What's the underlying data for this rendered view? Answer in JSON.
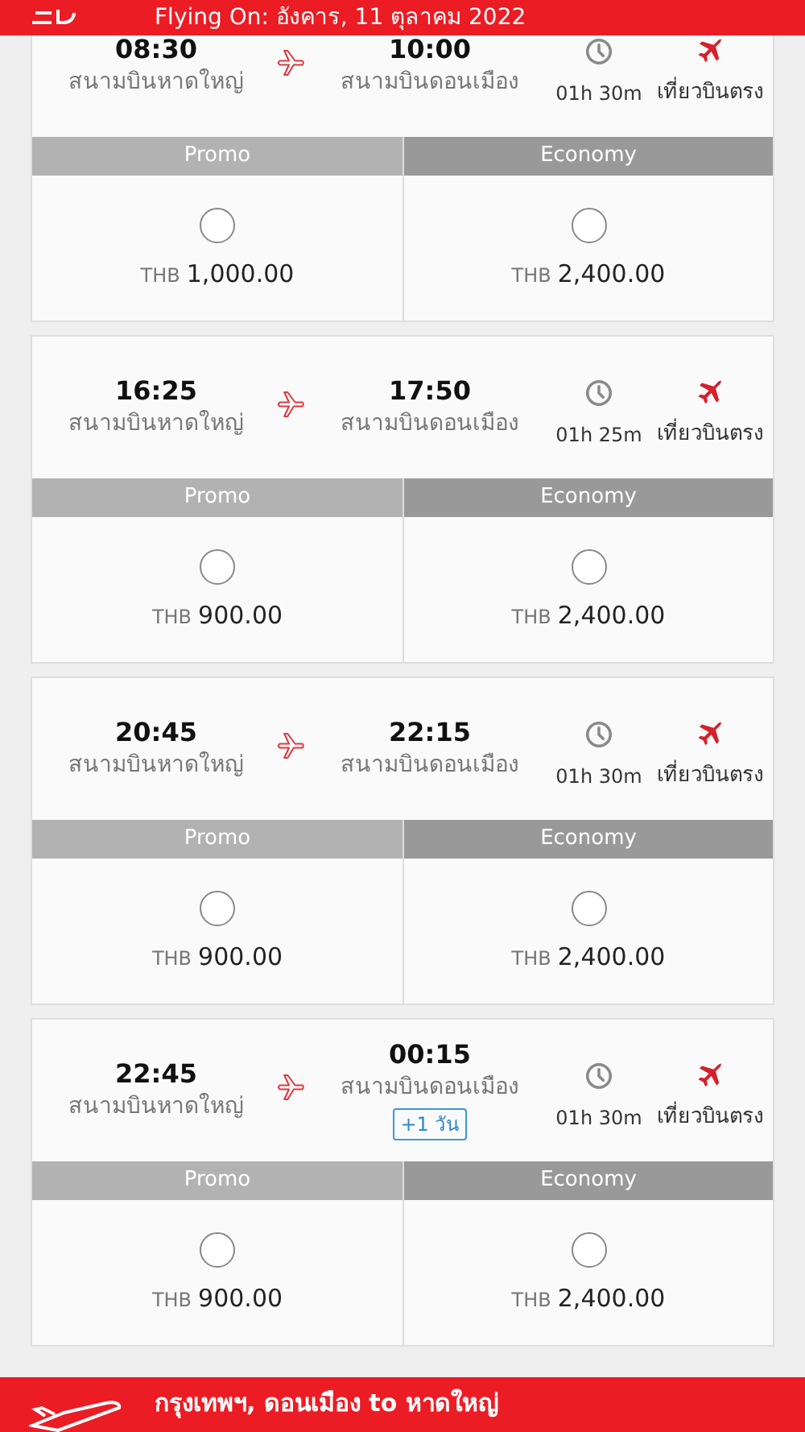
{
  "header": {
    "title": "Flying On: อังคาร, 11 ตุลาคม 2022"
  },
  "flights": [
    {
      "depart_time": "08:30",
      "depart_airport": "สนามบินหาดใหญ่",
      "arrive_time": "10:00",
      "arrive_airport": "สนามบินดอนเมือง",
      "duration": "01h 30m",
      "flight_type": "เที่ยวบินตรง",
      "fares": [
        {
          "class": "Promo",
          "selected": false,
          "currency": "THB",
          "amount": "1,000.00"
        },
        {
          "class": "Economy",
          "selected": false,
          "currency": "THB",
          "amount": "2,400.00"
        }
      ]
    },
    {
      "depart_time": "16:25",
      "depart_airport": "สนามบินหาดใหญ่",
      "arrive_time": "17:50",
      "arrive_airport": "สนามบินดอนเมือง",
      "duration": "01h 25m",
      "flight_type": "เที่ยวบินตรง",
      "fares": [
        {
          "class": "Promo",
          "selected": false,
          "currency": "THB",
          "amount": "900.00"
        },
        {
          "class": "Economy",
          "selected": false,
          "currency": "THB",
          "amount": "2,400.00"
        }
      ]
    },
    {
      "depart_time": "20:45",
      "depart_airport": "สนามบินหาดใหญ่",
      "arrive_time": "22:15",
      "arrive_airport": "สนามบินดอนเมือง",
      "duration": "01h 30m",
      "flight_type": "เที่ยวบินตรง",
      "fares": [
        {
          "class": "Promo",
          "selected": false,
          "currency": "THB",
          "amount": "900.00"
        },
        {
          "class": "Economy",
          "selected": false,
          "currency": "THB",
          "amount": "2,400.00"
        }
      ]
    },
    {
      "depart_time": "22:45",
      "depart_airport": "สนามบินหาดใหญ่",
      "arrive_time": "00:15",
      "arrive_airport": "สนามบินดอนเมือง",
      "next_day": "+1 วัน",
      "duration": "01h 30m",
      "flight_type": "เที่ยวบินตรง",
      "fares": [
        {
          "class": "Promo",
          "selected": false,
          "currency": "THB",
          "amount": "900.00"
        },
        {
          "class": "Economy",
          "selected": false,
          "currency": "THB",
          "amount": "2,400.00"
        }
      ]
    }
  ],
  "bottom_bar": {
    "route": "กรุงเทพฯ, ดอนเมือง to หาดใหญ่"
  }
}
